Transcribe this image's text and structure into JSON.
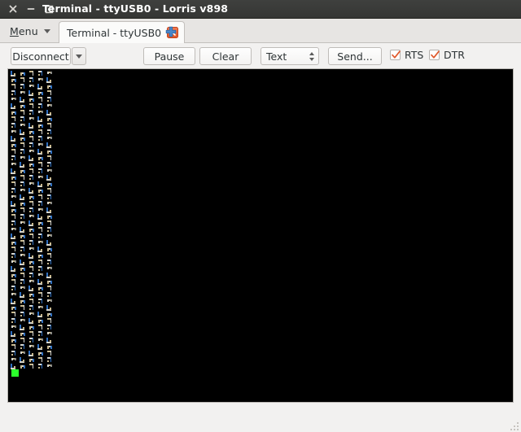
{
  "window": {
    "title": "Terminal - ttyUSB0 - Lorris v898",
    "controls": [
      {
        "name": "close-button",
        "icon": "close-icon",
        "glyph": "×"
      },
      {
        "name": "minimize-button",
        "icon": "minimize-icon",
        "glyph": "−"
      },
      {
        "name": "maximize-button",
        "icon": "maximize-icon",
        "glyph": "□"
      }
    ]
  },
  "tabbar": {
    "menu_label_prefix": "M",
    "menu_label_rest": "enu",
    "menu_label": "Menu",
    "menu_arrow_icon": "chevron-down-icon",
    "tabs": [
      {
        "label": "Terminal - ttyUSB0",
        "active": true,
        "close_icon": "close-icon",
        "close_glyph": "×"
      }
    ],
    "new_tab_icon": "plus-icon"
  },
  "toolbar": {
    "disconnect_label": "Disconnect",
    "disconnect_arrow_icon": "chevron-down-icon",
    "pause_label": "Pause",
    "clear_label": "Clear",
    "format_value": "Text",
    "format_spinner_icon": "spinner-updown-icon",
    "send_label": "Send...",
    "checkboxes": [
      {
        "label": "RTS",
        "checked": true,
        "icon": "checkmark-icon"
      },
      {
        "label": "DTR",
        "checked": true,
        "icon": "checkmark-icon"
      }
    ]
  },
  "terminal": {
    "background_color": "#000000",
    "cursor_color": "#2bff2b",
    "cursor_visible": true,
    "line_count": 46,
    "glyphs_per_line": 5,
    "glyph_colors": [
      "#2f6fbf",
      "#d6d6d0",
      "#c9b98f",
      "#8a8a86"
    ],
    "content_note": "repeating unreadable control glyph pattern"
  },
  "statusbar": {
    "grip_icon": "resize-grip-icon"
  }
}
